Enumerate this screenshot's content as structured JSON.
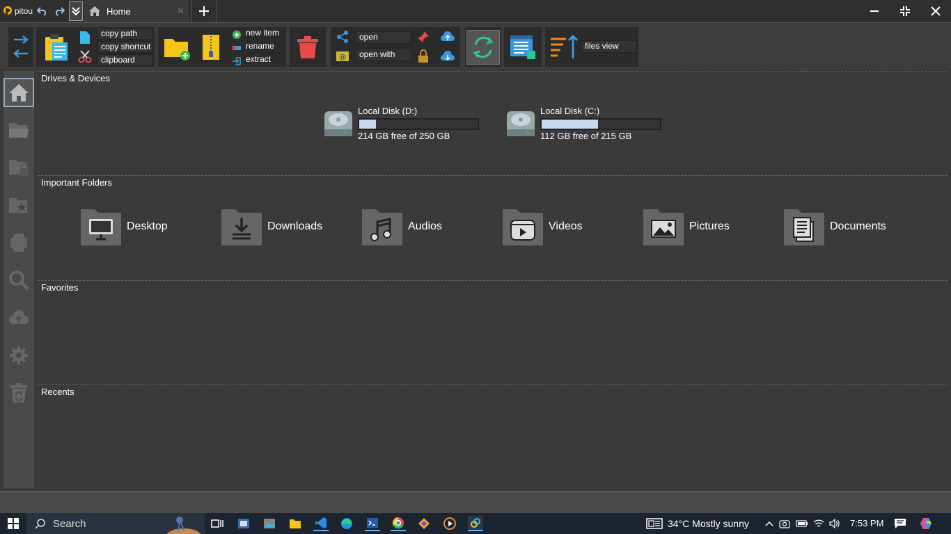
{
  "titlebar": {
    "app_name": "pitou",
    "tab_label": "Home"
  },
  "toolbar": {
    "copy_path": "copy path",
    "copy_shortcut": "copy shortcut",
    "clipboard": "clipboard",
    "new_item": "new item",
    "rename": "rename",
    "extract": "extract",
    "open": "open",
    "open_with": "open with",
    "files_view": "files view"
  },
  "sections": {
    "drives": "Drives & Devices",
    "important": "Important Folders",
    "favorites": "Favorites",
    "recents": "Recents"
  },
  "drives": [
    {
      "name": "Local Disk (D:)",
      "free": "214 GB free of 250 GB",
      "used_fraction": 0.144
    },
    {
      "name": "Local Disk (C:)",
      "free": "112 GB free of 215 GB",
      "used_fraction": 0.479
    }
  ],
  "folders": [
    "Desktop",
    "Downloads",
    "Audios",
    "Videos",
    "Pictures",
    "Documents"
  ],
  "taskbar": {
    "search_label": "Search",
    "weather": "34°C  Mostly sunny",
    "time": "7:53 PM"
  },
  "colors": {
    "accent_blue": "#3a9ad9",
    "folder_yellow": "#f5c518",
    "trash_red": "#e84a4a",
    "refresh_green": "#2ec4a0",
    "drive_fill": "#c6d9f0"
  }
}
